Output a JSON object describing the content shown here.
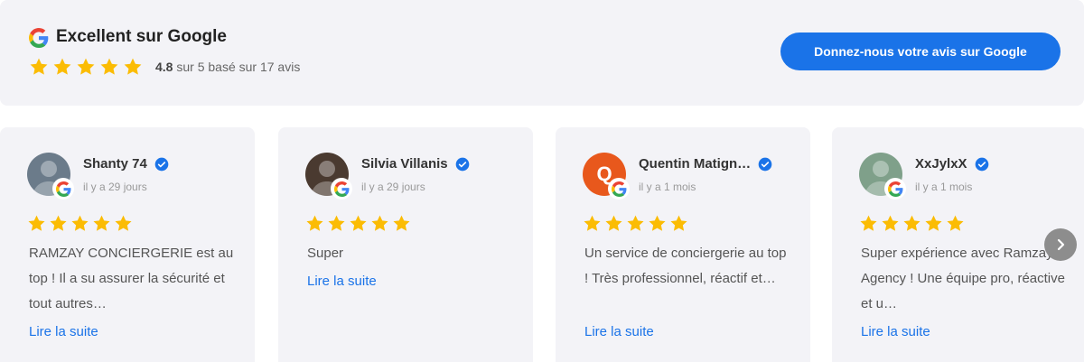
{
  "header": {
    "title": "Excellent sur Google",
    "rating": "4.8",
    "rating_text": "sur 5 basé sur 17 avis",
    "stars": 5,
    "cta_label": "Donnez-nous votre avis sur Google"
  },
  "reviews": [
    {
      "name": "Shanty 74",
      "date": "il y a 29 jours",
      "stars": 5,
      "text": "RAMZAY CONCIERGERIE est au top ! Il a su assurer la sécurité et tout autres…",
      "read_more": "Lire la suite",
      "avatar_color": "#6b7b8a"
    },
    {
      "name": "Silvia Villanis",
      "date": "il y a 29 jours",
      "stars": 5,
      "text": "Super",
      "read_more": "Lire la suite",
      "avatar_color": "#4a3a30"
    },
    {
      "name": "Quentin Matign…",
      "date": "il y a 1 mois",
      "stars": 5,
      "text": "Un service de conciergerie au top ! Très professionnel, réactif et…",
      "read_more": "Lire la suite",
      "avatar_letter": "Q",
      "avatar_color": "#e8581c"
    },
    {
      "name": "XxJylxX",
      "date": "il y a 1 mois",
      "stars": 5,
      "text": "Super expérience avec Ramzay Agency ! Une équipe pro, réactive et u…",
      "read_more": "Lire la suite",
      "avatar_color": "#7fa08a"
    }
  ],
  "colors": {
    "star": "#fbbc04",
    "link": "#1a73e8",
    "cta": "#1a73e8",
    "verified": "#1a73e8",
    "panel": "#f3f3f7"
  },
  "icons": {
    "google": "google-logo-icon",
    "star": "star-icon",
    "verified": "verified-badge-icon",
    "next": "chevron-right-icon"
  }
}
